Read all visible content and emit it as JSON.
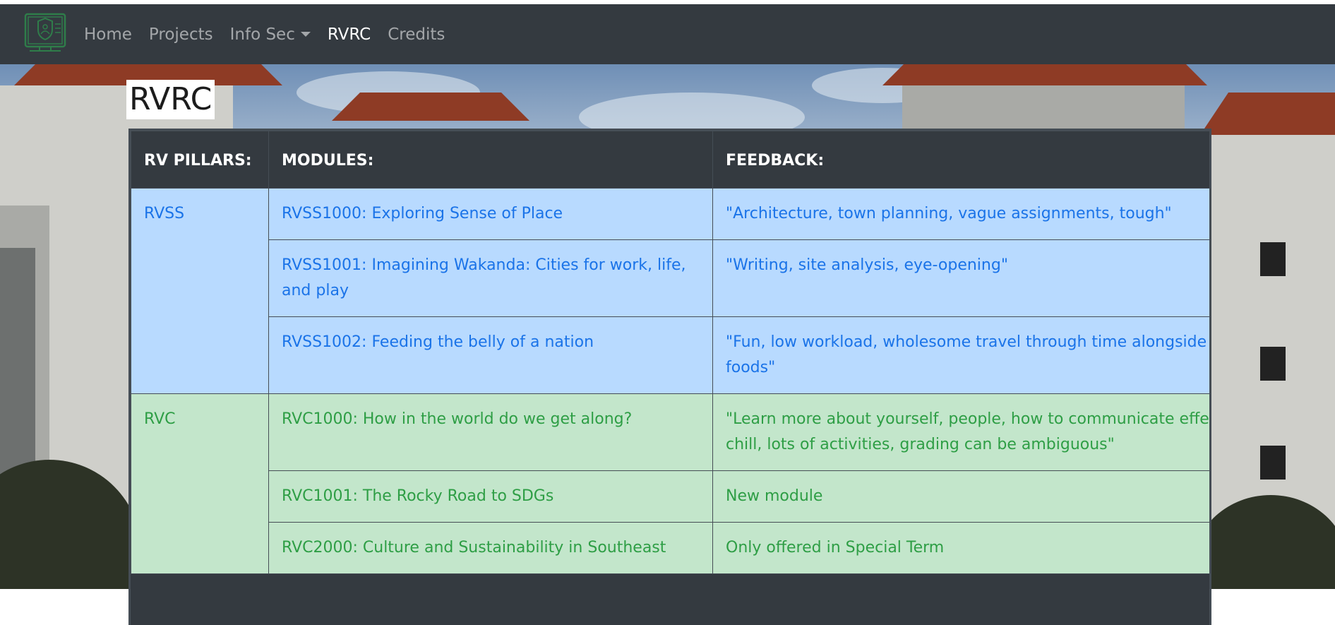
{
  "nav": {
    "items": [
      {
        "label": "Home",
        "active": false
      },
      {
        "label": "Projects",
        "active": false
      },
      {
        "label": "Info Sec",
        "active": false,
        "dropdown": true
      },
      {
        "label": "RVRC",
        "active": true
      },
      {
        "label": "Credits",
        "active": false
      }
    ],
    "brand_icon": "security-monitor-icon"
  },
  "page": {
    "title": "RVRC"
  },
  "table": {
    "headers": [
      "RV PILLARS:",
      "MODULES:",
      "FEEDBACK:"
    ],
    "groups": [
      {
        "pillar": "RVSS",
        "color": "#b8daff",
        "rows": [
          {
            "module": "RVSS1000: Exploring Sense of Place",
            "feedback": "\"Architecture, town planning, vague assignments, tough\""
          },
          {
            "module": "RVSS1001: Imagining Wakanda: Cities for work, life, and play",
            "feedback": "\"Writing, site analysis, eye-opening\""
          },
          {
            "module": "RVSS1002: Feeding the belly of a nation",
            "feedback": "\"Fun, low workload, wholesome travel through time alongside our foods\""
          }
        ]
      },
      {
        "pillar": "RVC",
        "color": "#c3e6cb",
        "rows": [
          {
            "module": "RVC1000: How in the world do we get along?",
            "feedback": "\"Learn more about yourself, people, how to communicate effectively, chill, lots of activities, grading can be ambiguous\""
          },
          {
            "module": "RVC1001: The Rocky Road to SDGs",
            "feedback": "New module"
          },
          {
            "module": "RVC2000: Culture and Sustainability in Southeast",
            "feedback": "Only offered in Special Term"
          }
        ]
      }
    ]
  }
}
